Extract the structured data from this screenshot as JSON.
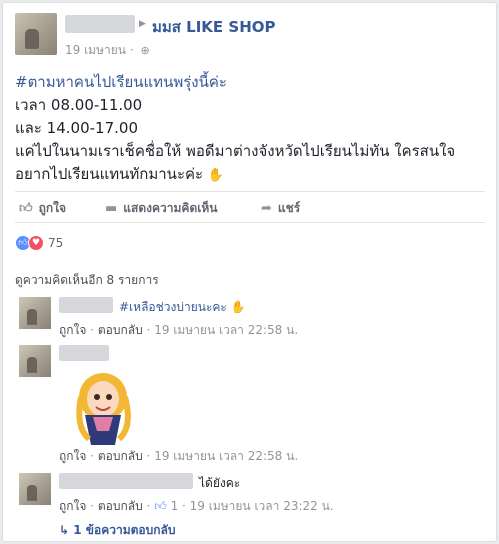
{
  "post": {
    "page_name": "มมส LIKE SHOP",
    "date": "19 เมษายน",
    "lines": {
      "hashtag": "#ตามหาคนไปเรียนแทนพรุ่งนี้ค่ะ",
      "line1": "เวลา 08.00-11.00",
      "line2": "และ 14.00-17.00",
      "line3": "แค่ไปในนามเราเช็คชื่อให้ พอดีมาต่างจังหวัดไปเรียนไม่ทัน ใครสนใจ",
      "line4": "อยากไปเรียนแทนทักมานะค่ะ"
    }
  },
  "actions": {
    "like": "ถูกใจ",
    "comment": "แสดงความคิดเห็น",
    "share": "แชร์"
  },
  "reactions": {
    "count": "75"
  },
  "comments": {
    "more_label": "ดูความคิดเห็นอีก 8 รายการ",
    "c1": {
      "text": "#เหลือช่วงบ่ายนะคะ",
      "like": "ถูกใจ",
      "reply": "ตอบกลับ",
      "time": "19 เมษายน เวลา 22:58 น."
    },
    "c2": {
      "like": "ถูกใจ",
      "reply": "ตอบกลับ",
      "time": "19 เมษายน เวลา 22:58 น."
    },
    "c3": {
      "text": "ได้ยังคะ",
      "like": "ถูกใจ",
      "reply": "ตอบกลับ",
      "like_count": "1",
      "time": "19 เมษายน เวลา 23:22 น.",
      "replies": "1 ข้อความตอบกลับ"
    }
  }
}
